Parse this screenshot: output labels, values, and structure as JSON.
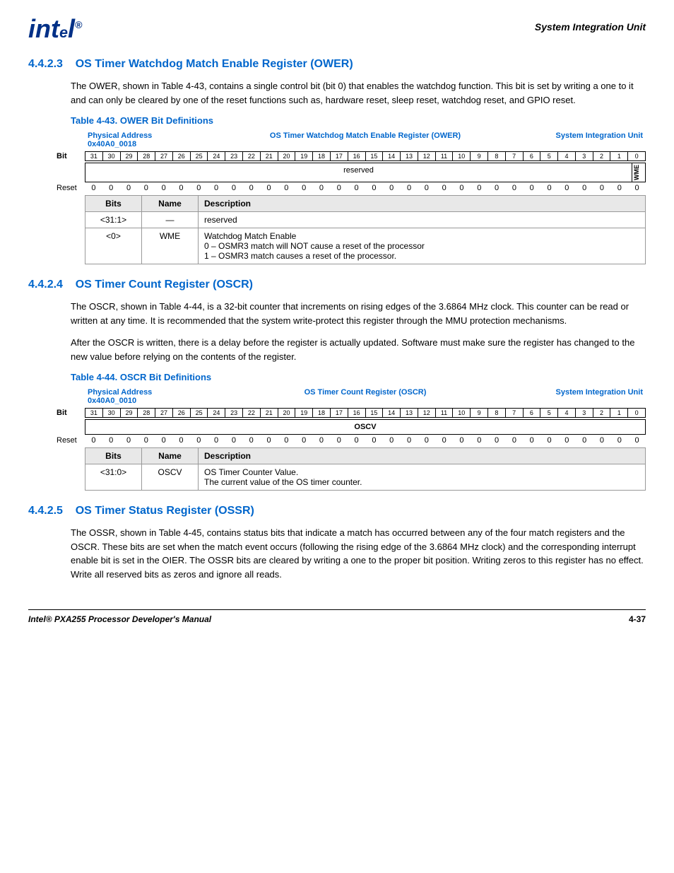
{
  "header": {
    "logo": "intₐl.",
    "subtitle": "System Integration Unit"
  },
  "sections": [
    {
      "id": "4.4.2.3",
      "title": "OS Timer Watchdog Match Enable Register (OWER)",
      "body1": "The OWER, shown in Table 4-43, contains a single control bit (bit 0) that enables the watchdog function. This bit is set by writing a one to it and can only be cleared by one of the reset functions such as, hardware reset, sleep reset, watchdog reset, and GPIO reset.",
      "table_title": "Table 4-43. OWER Bit Definitions",
      "phys_addr_label": "Physical Address",
      "phys_addr_val": "0x40A0_0018",
      "reg_name_label": "OS Timer Watchdog Match Enable Register (OWER)",
      "siu_label": "System Integration Unit",
      "bit_label": "Bit",
      "reset_label": "Reset",
      "bits_header": "Bits",
      "name_header": "Name",
      "desc_header": "Description",
      "bits": [
        31,
        30,
        29,
        28,
        27,
        26,
        25,
        24,
        23,
        22,
        21,
        20,
        19,
        18,
        17,
        16,
        15,
        14,
        13,
        12,
        11,
        10,
        9,
        8,
        7,
        6,
        5,
        4,
        3,
        2,
        1,
        0
      ],
      "reset_vals": [
        "0",
        "0",
        "0",
        "0",
        "0",
        "0",
        "0",
        "0",
        "0",
        "0",
        "0",
        "0",
        "0",
        "0",
        "0",
        "0",
        "0",
        "0",
        "0",
        "0",
        "0",
        "0",
        "0",
        "0",
        "0",
        "0",
        "0",
        "0",
        "0",
        "0",
        "0",
        "0"
      ],
      "reserved_label": "reserved",
      "wme_label": "WME",
      "rows": [
        {
          "bits": "<31:1>",
          "name": "—",
          "desc": "reserved"
        },
        {
          "bits": "<0>",
          "name": "WME",
          "desc": "Watchdog Match Enable\n0 – OSMR3 match will NOT cause a reset of the processor\n1 – OSMR3 match causes a reset of the processor."
        }
      ]
    },
    {
      "id": "4.4.2.4",
      "title": "OS Timer Count Register (OSCR)",
      "body1": "The OSCR, shown in Table 4-44, is a 32-bit counter that increments on rising edges of the 3.6864 MHz clock. This counter can be read or written at any time. It is recommended that the system write-protect this register through the MMU protection mechanisms.",
      "body2": "After the OSCR is written, there is a delay before the register is actually updated. Software must make sure the register has changed to the new value before relying on the contents of the register.",
      "table_title": "Table 4-44. OSCR Bit Definitions",
      "phys_addr_label": "Physical Address",
      "phys_addr_val": "0x40A0_0010",
      "reg_name_label": "OS Timer Count Register (OSCR)",
      "siu_label": "System Integration Unit",
      "bit_label": "Bit",
      "reset_label": "Reset",
      "bits_header": "Bits",
      "name_header": "Name",
      "desc_header": "Description",
      "bits": [
        31,
        30,
        29,
        28,
        27,
        26,
        25,
        24,
        23,
        22,
        21,
        20,
        19,
        18,
        17,
        16,
        15,
        14,
        13,
        12,
        11,
        10,
        9,
        8,
        7,
        6,
        5,
        4,
        3,
        2,
        1,
        0
      ],
      "reset_vals": [
        "0",
        "0",
        "0",
        "0",
        "0",
        "0",
        "0",
        "0",
        "0",
        "0",
        "0",
        "0",
        "0",
        "0",
        "0",
        "0",
        "0",
        "0",
        "0",
        "0",
        "0",
        "0",
        "0",
        "0",
        "0",
        "0",
        "0",
        "0",
        "0",
        "0",
        "0",
        "0"
      ],
      "oscv_label": "OSCV",
      "rows": [
        {
          "bits": "<31:0>",
          "name": "OSCV",
          "desc": "OS Timer Counter Value.\nThe current value of the OS timer counter."
        }
      ]
    },
    {
      "id": "4.4.2.5",
      "title": "OS Timer Status Register (OSSR)",
      "body1": "The OSSR, shown in Table 4-45, contains status bits that indicate a match has occurred between any of the four match registers and the OSCR. These bits are set when the match event occurs (following the rising edge of the 3.6864 MHz clock) and the corresponding interrupt enable bit is set in the OIER. The OSSR bits are cleared by writing a one to the proper bit position. Writing zeros to this register has no effect. Write all reserved bits as zeros and ignore all reads."
    }
  ],
  "footer": {
    "left": "Intel® PXA255 Processor Developer's Manual",
    "right": "4-37"
  }
}
